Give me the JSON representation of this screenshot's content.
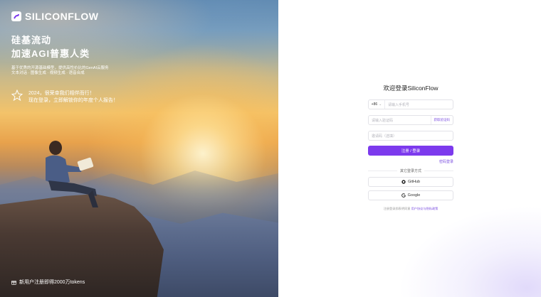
{
  "brand": {
    "name": "SILICONFLOW",
    "accent": "#7c3aed"
  },
  "hero": {
    "title_line1": "硅基流动",
    "title_line2": "加速AGI普惠人类",
    "subtitle_line1": "基于优秀的开源基础模型，提供高性价比的GenAI云服务",
    "subtitle_line2": "文本对话 · 图像生成 · 视频生成 · 语音合成",
    "announcement_line1": "2024，很荣幸我们相伴而行！",
    "announcement_line2": "现在登录，立即解锁你的年度个人报告！",
    "promo_text": "新用户注册即得2000万tokens"
  },
  "login": {
    "title": "欢迎登录SiliconFlow",
    "country_code": "+86",
    "phone_placeholder": "请输入手机号",
    "code_placeholder": "请输入验证码",
    "get_code_label": "获取验证码",
    "invite_placeholder": "邀请码（选填）",
    "submit_label": "注册 / 登录",
    "password_login_label": "密码登录",
    "other_methods_label": "其它登录方式",
    "github_label": "GitHub",
    "google_label": "Google",
    "terms_prefix": "注册登录即表明同意",
    "terms_link": "用户协议与隐私政策"
  }
}
